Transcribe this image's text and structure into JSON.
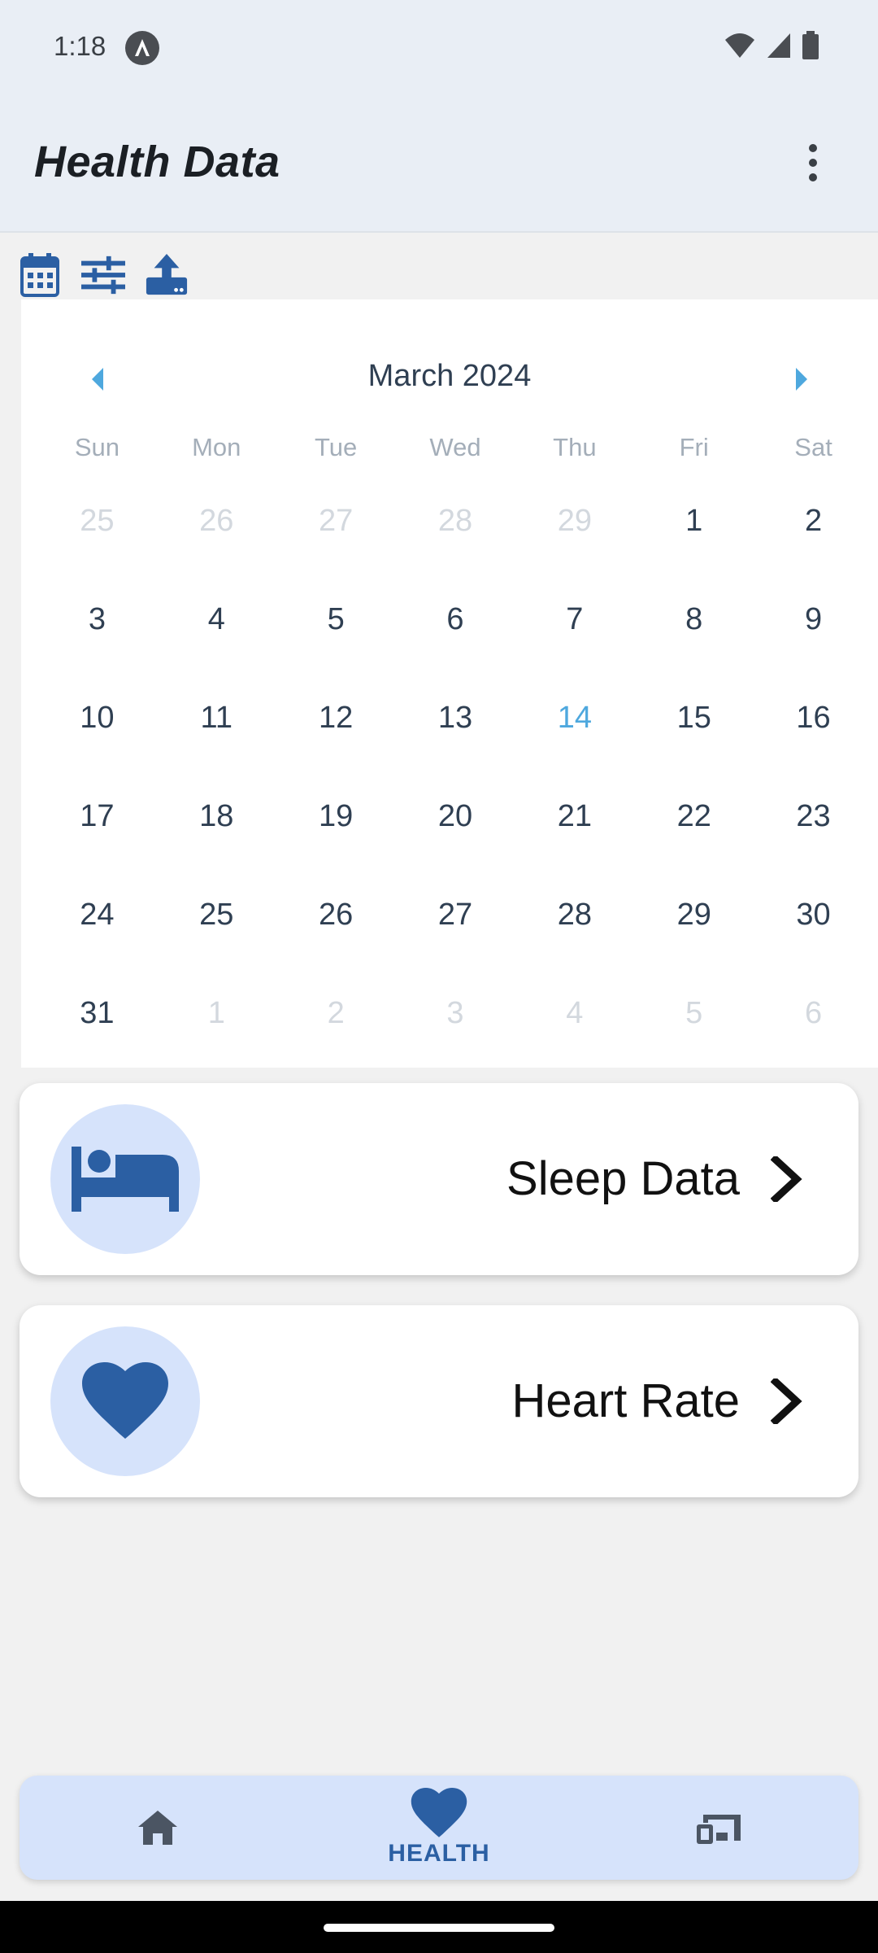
{
  "status_bar": {
    "time": "1:18"
  },
  "app_bar": {
    "title": "Health Data",
    "overflow_icon": "more-vert-icon"
  },
  "toolbar": {
    "icons": [
      "calendar-icon",
      "tune-icon",
      "upload-icon"
    ]
  },
  "calendar": {
    "month_title": "March 2024",
    "weekdays": [
      "Sun",
      "Mon",
      "Tue",
      "Wed",
      "Thu",
      "Fri",
      "Sat"
    ],
    "days": [
      {
        "label": "25",
        "state": "muted"
      },
      {
        "label": "26",
        "state": "muted"
      },
      {
        "label": "27",
        "state": "muted"
      },
      {
        "label": "28",
        "state": "muted"
      },
      {
        "label": "29",
        "state": "muted"
      },
      {
        "label": "1",
        "state": "normal"
      },
      {
        "label": "2",
        "state": "normal"
      },
      {
        "label": "3",
        "state": "normal"
      },
      {
        "label": "4",
        "state": "normal"
      },
      {
        "label": "5",
        "state": "normal"
      },
      {
        "label": "6",
        "state": "normal"
      },
      {
        "label": "7",
        "state": "normal"
      },
      {
        "label": "8",
        "state": "normal"
      },
      {
        "label": "9",
        "state": "normal"
      },
      {
        "label": "10",
        "state": "normal"
      },
      {
        "label": "11",
        "state": "normal"
      },
      {
        "label": "12",
        "state": "normal"
      },
      {
        "label": "13",
        "state": "normal"
      },
      {
        "label": "14",
        "state": "today"
      },
      {
        "label": "15",
        "state": "normal"
      },
      {
        "label": "16",
        "state": "normal"
      },
      {
        "label": "17",
        "state": "normal"
      },
      {
        "label": "18",
        "state": "normal"
      },
      {
        "label": "19",
        "state": "normal"
      },
      {
        "label": "20",
        "state": "normal"
      },
      {
        "label": "21",
        "state": "normal"
      },
      {
        "label": "22",
        "state": "normal"
      },
      {
        "label": "23",
        "state": "normal"
      },
      {
        "label": "24",
        "state": "normal"
      },
      {
        "label": "25",
        "state": "normal"
      },
      {
        "label": "26",
        "state": "normal"
      },
      {
        "label": "27",
        "state": "normal"
      },
      {
        "label": "28",
        "state": "normal"
      },
      {
        "label": "29",
        "state": "normal"
      },
      {
        "label": "30",
        "state": "normal"
      },
      {
        "label": "31",
        "state": "normal"
      },
      {
        "label": "1",
        "state": "muted"
      },
      {
        "label": "2",
        "state": "muted"
      },
      {
        "label": "3",
        "state": "muted"
      },
      {
        "label": "4",
        "state": "muted"
      },
      {
        "label": "5",
        "state": "muted"
      },
      {
        "label": "6",
        "state": "muted"
      }
    ]
  },
  "cards": [
    {
      "label": "Sleep Data",
      "icon": "bed-icon"
    },
    {
      "label": "Heart Rate",
      "icon": "heart-icon"
    }
  ],
  "bottom_nav": {
    "items": [
      {
        "icon": "home-icon",
        "label": ""
      },
      {
        "icon": "heart-icon",
        "label": "HEALTH",
        "active": true
      },
      {
        "icon": "devices-icon",
        "label": ""
      }
    ]
  },
  "colors": {
    "accent": "#2b5fa3",
    "today": "#4ea8de",
    "card_icon_bg": "#d6e3fb",
    "app_bar_bg": "#e9eef5"
  }
}
